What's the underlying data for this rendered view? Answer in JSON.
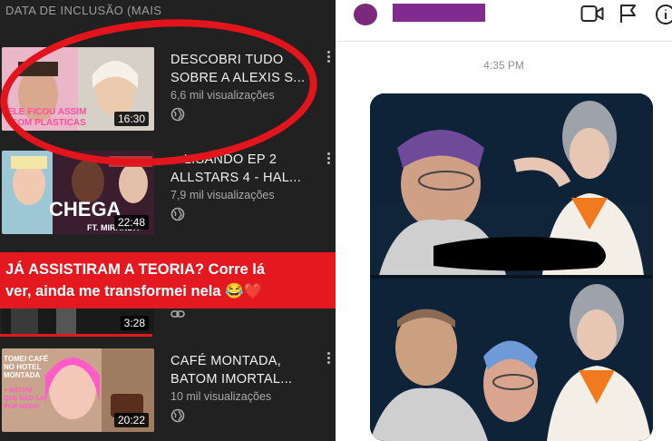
{
  "youtube": {
    "sort_label": "DATA DE INCLUSÃO (MAIS",
    "videos": [
      {
        "title_line1": "DESCOBRI TUDO",
        "title_line2": "SOBRE A ALEXIS S...",
        "views": "6,6 mil visualizações",
        "duration": "16:30",
        "thumb_caption_1": "ELE FICOU ASSIM",
        "thumb_caption_2": "COM PLÁSTICAS"
      },
      {
        "title_line1": "…LISANDO EP 2",
        "title_line2": "ALLSTARS 4 - HAL...",
        "views": "7,9 mil visualizações",
        "duration": "22:48",
        "thumb_caption_1": "CHEGA",
        "thumb_caption_2": "FT. MIRANDA"
      },
      {
        "duration": "3:28"
      },
      {
        "title_line1": "CAFÉ MONTADA,",
        "title_line2": "BATOM IMORTAL...",
        "views": "10 mil visualizações",
        "duration": "20:22",
        "thumb_caption_1": "TOMEI CAFÉ NO HOTEL MONTADA",
        "thumb_caption_2": "+ BATOM QUE NÃO SAI POR NADA!"
      }
    ],
    "banner_line1": "JÁ ASSISTIRAM A TEORIA? Corre lá",
    "banner_line2": "ver, ainda me transformei nela 😂❤️"
  },
  "chat": {
    "timestamp": "4:35 PM",
    "icons": [
      "video-call-icon",
      "flag-icon",
      "info-icon"
    ]
  },
  "colors": {
    "youtube_bg": "#212121",
    "banner_red": "#e4191f",
    "circle_red": "#e2141c",
    "redact_purple": "#812b91"
  }
}
